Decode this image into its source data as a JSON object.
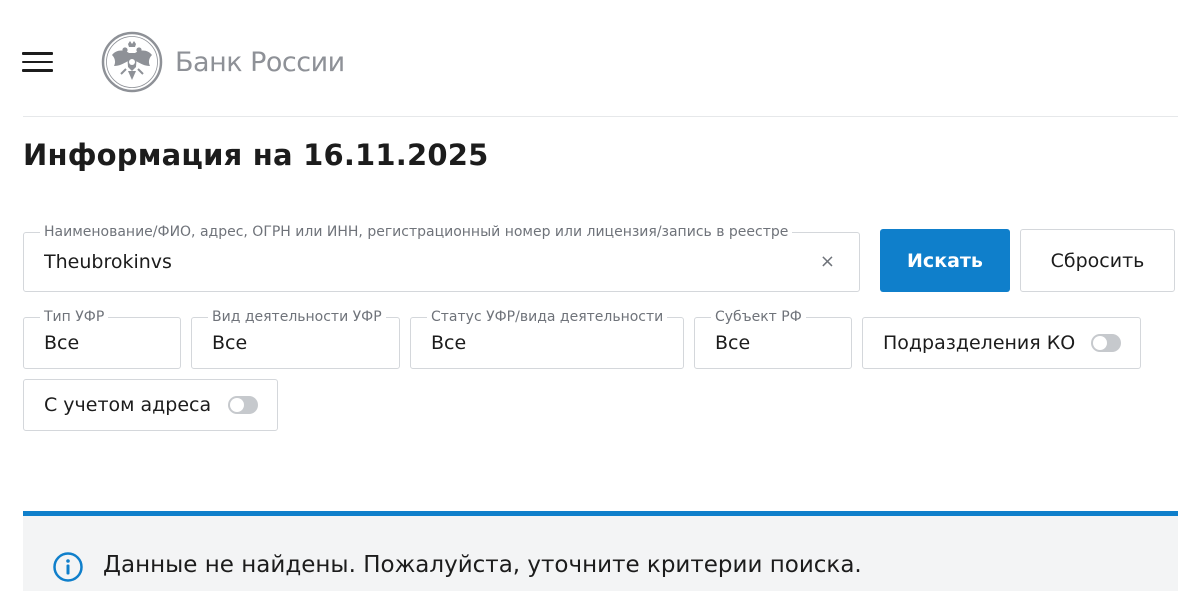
{
  "header": {
    "logo_text": "Банк России"
  },
  "page": {
    "title": "Информация на 16.11.2025"
  },
  "search": {
    "label": "Наименование/ФИО, адрес, ОГРН или ИНН, регистрационный номер или лицензия/запись в реестре",
    "value": "Theubrokinvs",
    "clear_glyph": "×",
    "submit_label": "Искать",
    "reset_label": "Сбросить"
  },
  "filters": {
    "type_label": "Тип УФР",
    "type_value": "Все",
    "activity_label": "Вид деятельности УФР",
    "activity_value": "Все",
    "status_label": "Статус УФР/вида деятельности",
    "status_value": "Все",
    "region_label": "Субъект РФ",
    "region_value": "Все",
    "branches_toggle_label": "Подразделения КО",
    "branches_toggle_on": false,
    "address_toggle_label": "С учетом адреса",
    "address_toggle_on": false
  },
  "notice": {
    "text": "Данные не найдены. Пожалуйста, уточните критерии поиска."
  },
  "colors": {
    "accent": "#0f7fcb",
    "border": "#d4d7db",
    "notice_bg": "#f3f4f5",
    "logo_gray": "#8e9197"
  },
  "icons": {
    "menu": "hamburger-menu-icon",
    "emblem": "double-headed-eagle-emblem-icon",
    "clear": "close-icon",
    "info": "info-circle-icon"
  }
}
